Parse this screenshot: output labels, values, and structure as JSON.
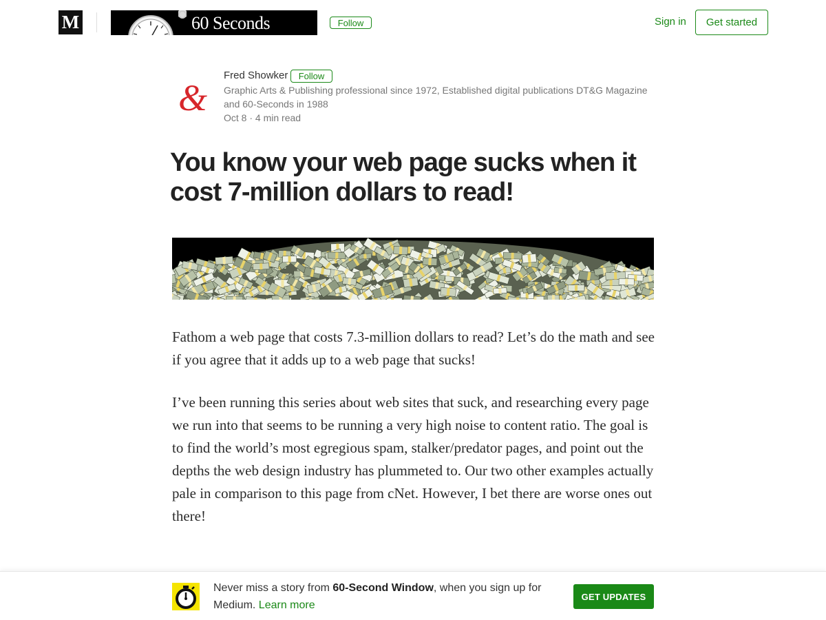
{
  "topnav": {
    "logo_letter": "M",
    "publication_banner_text": "60 Seconds",
    "follow_label": "Follow",
    "sign_in_label": "Sign in",
    "get_started_label": "Get started"
  },
  "author": {
    "avatar_glyph": "&",
    "name": "Fred Showker",
    "follow_label": "Follow",
    "bio": "Graphic Arts & Publishing professional since 1972, Established digital publications DT&G Magazine and 60-Seconds in 1988",
    "date": "Oct 8",
    "separator": "·",
    "read_time": "4 min read"
  },
  "article": {
    "title": "You know your web page sucks when it cost 7-million dollars to read!",
    "paragraphs": [
      "Fathom a web page that costs 7.3-million dollars to read? Let’s do the math and see if you agree that it adds up to a web page that sucks!",
      "I’ve been running this series about web sites that suck, and researching every page we run into that seems to be running a very high noise to content ratio. The goal is to find the world’s most egregious spam, stalker/predator pages, and point out the depths the web design industry has plummeted to. Our two other examples actually pale in comparison to this page from cNet. However, I bet there are worse ones out there!"
    ]
  },
  "bottom_bar": {
    "text_before": "Never miss a story from ",
    "publication_name": "60-Second Window",
    "text_after": ", when you sign up for Medium. ",
    "learn_more_label": "Learn more",
    "get_updates_label": "GET UPDATES"
  },
  "colors": {
    "accent_green": "#1a8917",
    "avatar_red": "#d7262b",
    "pub_icon_yellow": "#f5e400"
  },
  "icons": {
    "logo": "medium-logo-icon",
    "banner_watch": "stopwatch-icon",
    "pub_icon": "stopwatch-icon"
  }
}
